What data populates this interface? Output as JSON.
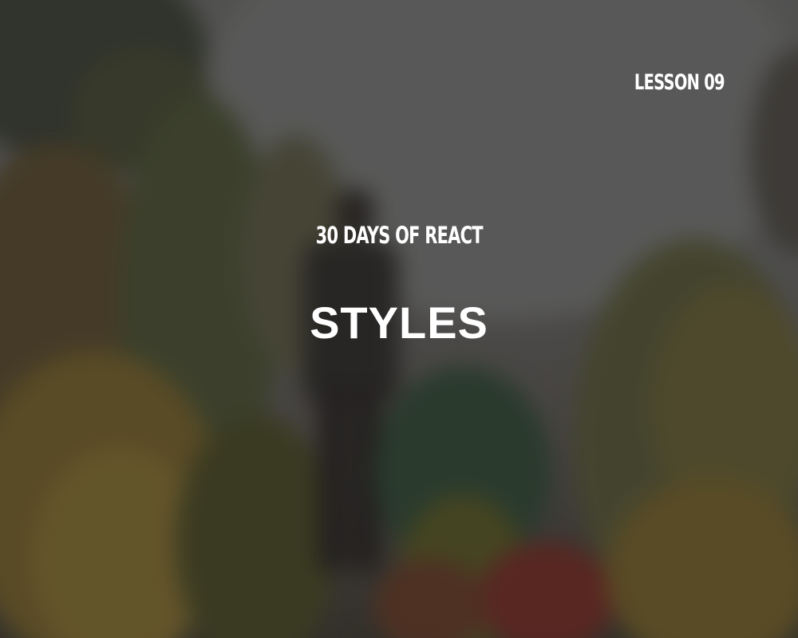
{
  "lesson_label": "LESSON 09",
  "series_title": "30 DAYS OF REACT",
  "lesson_title": "STYLES",
  "colors": {
    "text": "#ffffff",
    "overlay": "#232323",
    "sky": "#6f6f6e",
    "foliage_green": "#3f5a36",
    "foliage_autumn": "#8a6a2a",
    "foliage_red": "#8a2a22"
  }
}
